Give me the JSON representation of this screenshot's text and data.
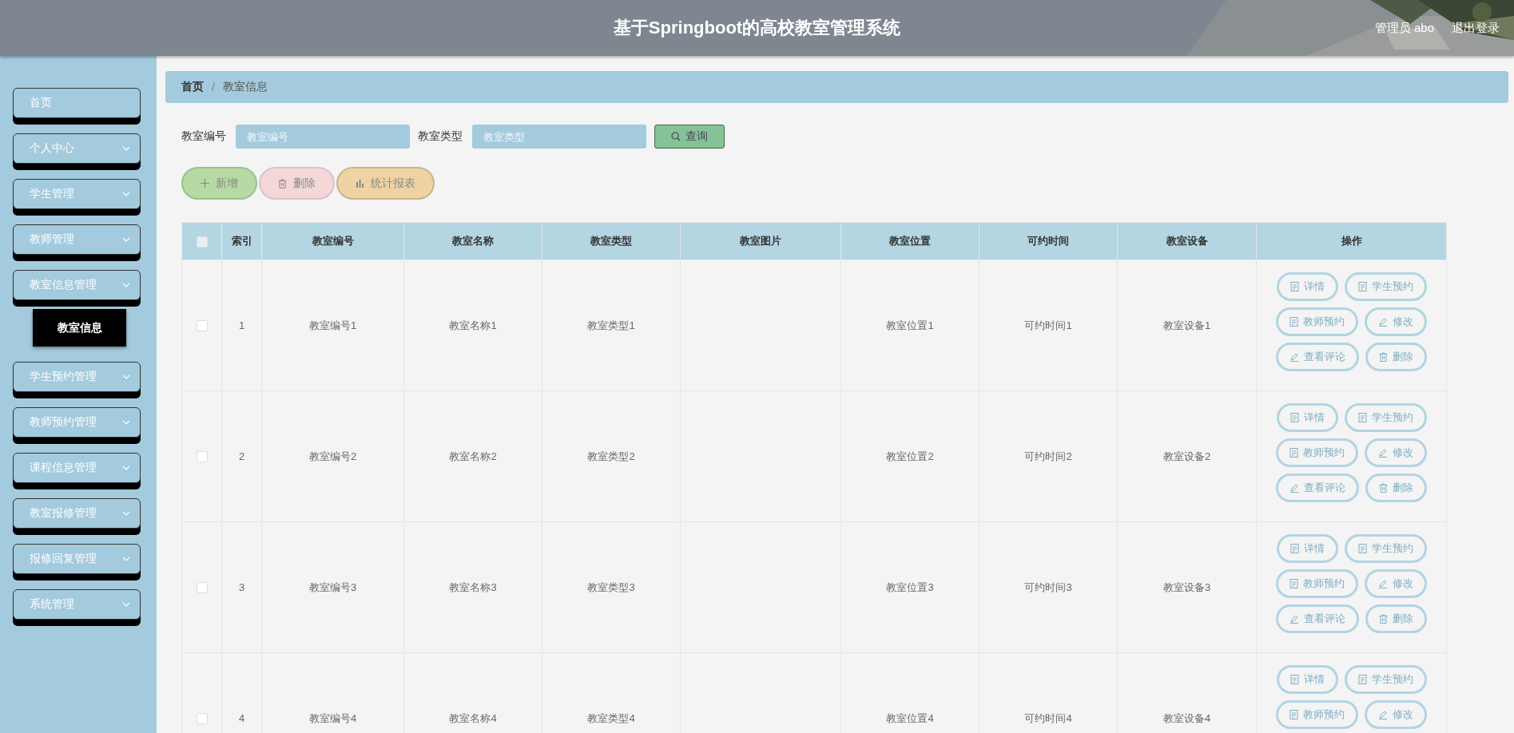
{
  "header": {
    "title": "基于Springboot的高校教室管理系统",
    "user": "管理员 abo",
    "logout": "退出登录"
  },
  "sidebar": {
    "items": [
      {
        "label": "首页",
        "kind": "link"
      },
      {
        "label": "个人中心",
        "kind": "menu"
      },
      {
        "label": "学生管理",
        "kind": "menu"
      },
      {
        "label": "教师管理",
        "kind": "menu"
      },
      {
        "label": "教室信息管理",
        "kind": "menu",
        "children": [
          {
            "label": "教室信息",
            "selected": true
          }
        ]
      },
      {
        "label": "学生预约管理",
        "kind": "menu"
      },
      {
        "label": "教师预约管理",
        "kind": "menu"
      },
      {
        "label": "课程信息管理",
        "kind": "menu"
      },
      {
        "label": "教室报修管理",
        "kind": "menu"
      },
      {
        "label": "报修回复管理",
        "kind": "menu"
      },
      {
        "label": "系统管理",
        "kind": "menu"
      }
    ]
  },
  "breadcrumb": {
    "items": [
      "首页",
      "教室信息"
    ],
    "separator": "/"
  },
  "search": {
    "fields": [
      {
        "label": "教室编号",
        "placeholder": "教室编号"
      },
      {
        "label": "教室类型",
        "placeholder": "教室类型"
      }
    ],
    "button": "查询"
  },
  "actions": [
    {
      "label": "新增",
      "kind": "add"
    },
    {
      "label": "删除",
      "kind": "delete"
    },
    {
      "label": "统计报表",
      "kind": "report"
    }
  ],
  "table": {
    "select_all_checked": false,
    "columns": [
      "索引",
      "教室编号",
      "教室名称",
      "教室类型",
      "教室图片",
      "教室位置",
      "可约时间",
      "教室设备",
      "操作"
    ],
    "rows": [
      {
        "checked": false,
        "index": "1",
        "number": "教室编号1",
        "name": "教室名称1",
        "type": "教室类型1",
        "location": "教室位置1",
        "time": "可约时间1",
        "equipment": "教室设备1",
        "actions": [
          {
            "label": "详情",
            "kind": "doc"
          },
          {
            "label": "学生预约",
            "kind": "doc"
          },
          {
            "label": "教师预约",
            "kind": "doc"
          },
          {
            "label": "修改",
            "kind": "pen"
          },
          {
            "label": "查看评论",
            "kind": "pen"
          },
          {
            "label": "删除",
            "kind": "trash"
          }
        ]
      },
      {
        "checked": false,
        "index": "2",
        "number": "教室编号2",
        "name": "教室名称2",
        "type": "教室类型2",
        "location": "教室位置2",
        "time": "可约时间2",
        "equipment": "教室设备2",
        "actions": [
          {
            "label": "详情",
            "kind": "doc"
          },
          {
            "label": "学生预约",
            "kind": "doc"
          },
          {
            "label": "教师预约",
            "kind": "doc"
          },
          {
            "label": "修改",
            "kind": "pen"
          },
          {
            "label": "查看评论",
            "kind": "pen"
          },
          {
            "label": "删除",
            "kind": "trash"
          }
        ]
      },
      {
        "checked": false,
        "index": "3",
        "number": "教室编号3",
        "name": "教室名称3",
        "type": "教室类型3",
        "location": "教室位置3",
        "time": "可约时间3",
        "equipment": "教室设备3",
        "actions": [
          {
            "label": "详情",
            "kind": "doc"
          },
          {
            "label": "学生预约",
            "kind": "doc"
          },
          {
            "label": "教师预约",
            "kind": "doc"
          },
          {
            "label": "修改",
            "kind": "pen"
          },
          {
            "label": "查看评论",
            "kind": "pen"
          },
          {
            "label": "删除",
            "kind": "trash"
          }
        ]
      },
      {
        "checked": false,
        "index": "4",
        "number": "教室编号4",
        "name": "教室名称4",
        "type": "教室类型4",
        "location": "教室位置4",
        "time": "可约时间4",
        "equipment": "教室设备4",
        "actions": [
          {
            "label": "详情",
            "kind": "doc"
          },
          {
            "label": "学生预约",
            "kind": "doc"
          },
          {
            "label": "教师预约",
            "kind": "doc"
          },
          {
            "label": "修改",
            "kind": "pen"
          }
        ]
      }
    ]
  }
}
